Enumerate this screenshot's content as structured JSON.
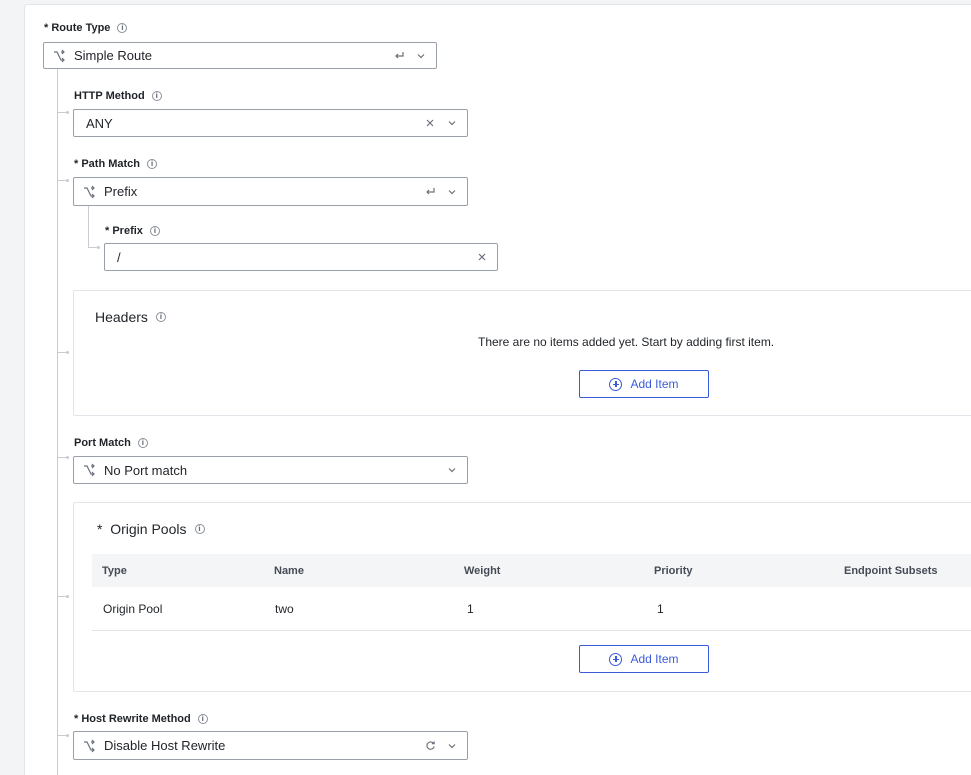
{
  "route_type": {
    "label": "Route Type",
    "value": "Simple Route"
  },
  "http_method": {
    "label": "HTTP Method",
    "value": "ANY"
  },
  "path_match": {
    "label": "Path Match",
    "value": "Prefix"
  },
  "prefix": {
    "label": "Prefix",
    "value": "/"
  },
  "headers": {
    "title": "Headers",
    "empty_message": "There are no items added yet. Start by adding first item.",
    "add_label": "Add Item"
  },
  "port_match": {
    "label": "Port Match",
    "value": "No Port match"
  },
  "origin_pools": {
    "title": "Origin Pools",
    "columns": [
      "Type",
      "Name",
      "Weight",
      "Priority",
      "Endpoint Subsets"
    ],
    "rows": [
      {
        "type": "Origin Pool",
        "name": "two",
        "weight": "1",
        "priority": "1",
        "endpoint_subsets": ""
      }
    ],
    "add_label": "Add Item"
  },
  "host_rewrite": {
    "label": "Host Rewrite Method",
    "value": "Disable Host Rewrite"
  },
  "required_marker": "*",
  "info_glyph": "i",
  "colors": {
    "accent": "#3b5bd9",
    "border": "#9aa0a8",
    "connector": "#c9ccd2"
  }
}
